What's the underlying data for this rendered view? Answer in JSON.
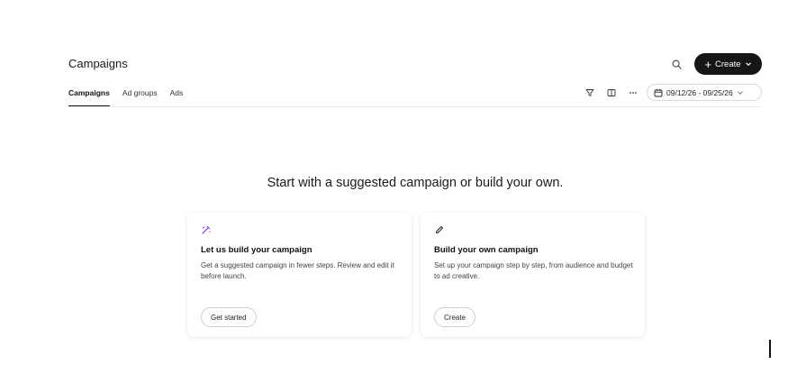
{
  "header": {
    "title": "Campaigns",
    "create_label": "Create"
  },
  "tabs": [
    {
      "label": "Campaigns",
      "active": true
    },
    {
      "label": "Ad groups",
      "active": false
    },
    {
      "label": "Ads",
      "active": false
    }
  ],
  "toolbar": {
    "date_range": "09/12/26 - 09/25/26",
    "icons": [
      "filter-icon",
      "columns-icon",
      "more-icon",
      "calendar-icon"
    ]
  },
  "main": {
    "headline": "Start with a suggested campaign or build your own.",
    "cards": [
      {
        "icon": "sparkle-pen-icon",
        "title": "Let us build your campaign",
        "description": "Get a suggested campaign in fewer steps. Review and edit it before launch.",
        "button": "Get started"
      },
      {
        "icon": "pencil-icon",
        "title": "Build your own campaign",
        "description": "Set up your campaign step by step, from audience and budget to ad creative.",
        "button": "Create"
      }
    ]
  },
  "colors": {
    "primary_button": "#161616",
    "accent_purple": "#7b2ff7",
    "divider": "#ececec"
  }
}
